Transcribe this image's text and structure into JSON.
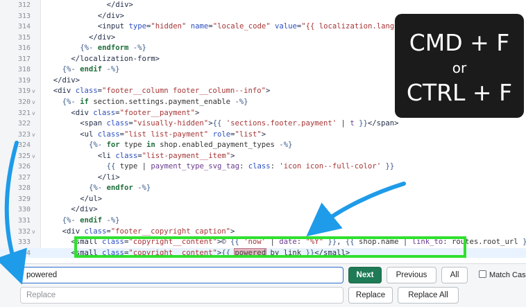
{
  "editor": {
    "lines": [
      {
        "num": "312",
        "fold": "",
        "indent": 14,
        "seg": [
          [
            "t-tag",
            "</div>"
          ]
        ]
      },
      {
        "num": "313",
        "fold": "",
        "indent": 12,
        "seg": [
          [
            "t-tag",
            "</div>"
          ]
        ]
      },
      {
        "num": "314",
        "fold": "",
        "indent": 12,
        "seg": [
          [
            "t-tag",
            "<input "
          ],
          [
            "t-attr",
            "type"
          ],
          [
            "t-tag",
            "="
          ],
          [
            "t-str",
            "\"hidden\""
          ],
          [
            "t-tag",
            " "
          ],
          [
            "t-attr",
            "name"
          ],
          [
            "t-tag",
            "="
          ],
          [
            "t-str",
            "\"locale_code\""
          ],
          [
            "t-tag",
            " "
          ],
          [
            "t-attr",
            "value"
          ],
          [
            "t-tag",
            "="
          ],
          [
            "t-str",
            "\"{{ localization.language.iso_code }}\">"
          ]
        ]
      },
      {
        "num": "315",
        "fold": "",
        "indent": 10,
        "seg": [
          [
            "t-tag",
            "</div>"
          ]
        ]
      },
      {
        "num": "316",
        "fold": "",
        "indent": 8,
        "seg": [
          [
            "t-liq",
            "{%- "
          ],
          [
            "t-kw",
            "endform"
          ],
          [
            "t-liq",
            " -%}"
          ]
        ]
      },
      {
        "num": "317",
        "fold": "",
        "indent": 6,
        "seg": [
          [
            "t-tag",
            "</localization-form>"
          ]
        ]
      },
      {
        "num": "318",
        "fold": "",
        "indent": 4,
        "seg": [
          [
            "t-liq",
            "{%- "
          ],
          [
            "t-kw",
            "endif"
          ],
          [
            "t-liq",
            " -%}"
          ]
        ]
      },
      {
        "num": "319",
        "fold": "",
        "indent": 2,
        "seg": [
          [
            "t-tag",
            "</div>"
          ]
        ]
      },
      {
        "num": "319",
        "fold": "v",
        "indent": 2,
        "seg": [
          [
            "t-tag",
            "<div "
          ],
          [
            "t-attr",
            "class"
          ],
          [
            "t-tag",
            "="
          ],
          [
            "t-str",
            "\"footer__column footer__column--info\""
          ],
          [
            "t-tag",
            ">"
          ]
        ]
      },
      {
        "num": "320",
        "fold": "v",
        "indent": 4,
        "seg": [
          [
            "t-liq",
            "{%- "
          ],
          [
            "t-kw",
            "if"
          ],
          [
            "t-var",
            " section.settings.payment_enable "
          ],
          [
            "t-liq",
            "-%}"
          ]
        ]
      },
      {
        "num": "321",
        "fold": "v",
        "indent": 6,
        "seg": [
          [
            "t-tag",
            "<div "
          ],
          [
            "t-attr",
            "class"
          ],
          [
            "t-tag",
            "="
          ],
          [
            "t-str",
            "\"footer__payment\""
          ],
          [
            "t-tag",
            ">"
          ]
        ]
      },
      {
        "num": "322",
        "fold": "",
        "indent": 8,
        "seg": [
          [
            "t-tag",
            "<span "
          ],
          [
            "t-attr",
            "class"
          ],
          [
            "t-tag",
            "="
          ],
          [
            "t-str",
            "\"visually-hidden\""
          ],
          [
            "t-tag",
            ">"
          ],
          [
            "t-liq",
            "{{ "
          ],
          [
            "t-str",
            "'sections.footer.payment'"
          ],
          [
            "t-var",
            " | "
          ],
          [
            "t-fn",
            "t"
          ],
          [
            "t-liq",
            " }}"
          ],
          [
            "t-tag",
            "</span>"
          ]
        ]
      },
      {
        "num": "323",
        "fold": "v",
        "indent": 8,
        "seg": [
          [
            "t-tag",
            "<ul "
          ],
          [
            "t-attr",
            "class"
          ],
          [
            "t-tag",
            "="
          ],
          [
            "t-str",
            "\"list list-payment\""
          ],
          [
            "t-tag",
            " "
          ],
          [
            "t-attr",
            "role"
          ],
          [
            "t-tag",
            "="
          ],
          [
            "t-str",
            "\"list\""
          ],
          [
            "t-tag",
            ">"
          ]
        ]
      },
      {
        "num": "324",
        "fold": "",
        "indent": 10,
        "seg": [
          [
            "t-liq",
            "{%- "
          ],
          [
            "t-kw",
            "for"
          ],
          [
            "t-var",
            " type "
          ],
          [
            "t-kw",
            "in"
          ],
          [
            "t-var",
            " shop.enabled_payment_types "
          ],
          [
            "t-liq",
            "-%}"
          ]
        ]
      },
      {
        "num": "325",
        "fold": "v",
        "indent": 12,
        "seg": [
          [
            "t-tag",
            "<li "
          ],
          [
            "t-attr",
            "class"
          ],
          [
            "t-tag",
            "="
          ],
          [
            "t-str",
            "\"list-payment__item\""
          ],
          [
            "t-tag",
            ">"
          ]
        ]
      },
      {
        "num": "326",
        "fold": "",
        "indent": 14,
        "seg": [
          [
            "t-liq",
            "{{ "
          ],
          [
            "t-var",
            "type | "
          ],
          [
            "t-fn",
            "payment_type_svg_tag"
          ],
          [
            "t-var",
            ": "
          ],
          [
            "t-attr",
            "class"
          ],
          [
            "t-var",
            ": "
          ],
          [
            "t-str",
            "'icon icon--full-color'"
          ],
          [
            "t-liq",
            " }}"
          ]
        ]
      },
      {
        "num": "327",
        "fold": "",
        "indent": 12,
        "seg": [
          [
            "t-tag",
            "</li>"
          ]
        ]
      },
      {
        "num": "328",
        "fold": "",
        "indent": 10,
        "seg": [
          [
            "t-liq",
            "{%- "
          ],
          [
            "t-kw",
            "endfor"
          ],
          [
            "t-liq",
            " -%}"
          ]
        ]
      },
      {
        "num": "329",
        "fold": "",
        "indent": 8,
        "seg": [
          [
            "t-tag",
            "</ul>"
          ]
        ]
      },
      {
        "num": "330",
        "fold": "",
        "indent": 6,
        "seg": [
          [
            "t-tag",
            "</div>"
          ]
        ]
      },
      {
        "num": "331",
        "fold": "",
        "indent": 4,
        "seg": [
          [
            "t-liq",
            "{%- "
          ],
          [
            "t-kw",
            "endif"
          ],
          [
            "t-liq",
            " -%}"
          ]
        ]
      },
      {
        "num": "332",
        "fold": "v",
        "indent": 4,
        "seg": [
          [
            "t-tag",
            "<div "
          ],
          [
            "t-attr",
            "class"
          ],
          [
            "t-tag",
            "="
          ],
          [
            "t-str",
            "\"footer__copyright caption\""
          ],
          [
            "t-tag",
            ">"
          ]
        ]
      },
      {
        "num": "333",
        "fold": "",
        "indent": 6,
        "seg": [
          [
            "t-tag",
            "<small "
          ],
          [
            "t-attr",
            "class"
          ],
          [
            "t-tag",
            "="
          ],
          [
            "t-str",
            "\"copyright__content\""
          ],
          [
            "t-tag",
            ">&copy; "
          ],
          [
            "t-liq",
            "{{ "
          ],
          [
            "t-str",
            "'now'"
          ],
          [
            "t-var",
            " | "
          ],
          [
            "t-fn",
            "date"
          ],
          [
            "t-var",
            ": "
          ],
          [
            "t-str",
            "\"%Y\""
          ],
          [
            "t-liq",
            " }}"
          ],
          [
            "t-tag",
            ", "
          ],
          [
            "t-liq",
            "{{ "
          ],
          [
            "t-var",
            "shop.name | "
          ],
          [
            "t-fn",
            "link_to"
          ],
          [
            "t-var",
            ": routes.root_url "
          ],
          [
            "t-liq",
            "}}"
          ],
          [
            "t-tag",
            "</small>"
          ]
        ]
      },
      {
        "num": "334",
        "fold": "",
        "indent": 6,
        "active": true,
        "seg": [
          [
            "t-tag",
            "<small "
          ],
          [
            "t-attr",
            "class"
          ],
          [
            "t-tag",
            "="
          ],
          [
            "t-str",
            "\"copyright__content\""
          ],
          [
            "t-tag",
            ">"
          ],
          [
            "t-liq",
            "{{ "
          ],
          [
            "hl-match",
            "powered"
          ],
          [
            "t-var",
            "_by_link "
          ],
          [
            "t-liq",
            "}}"
          ],
          [
            "t-tag",
            "</small>"
          ]
        ]
      }
    ]
  },
  "hint": {
    "line1": "CMD + F",
    "line2": "or",
    "line3": "CTRL + F"
  },
  "icons": {
    "arrow_left": "curved-arrow-icon",
    "arrow_right": "diagonal-arrow-icon"
  },
  "colors": {
    "arrow": "#1e9be9",
    "highlight_box": "#2fe02f",
    "next_button": "#1f7a56",
    "hint_card": "#1b1b1c"
  },
  "findbar": {
    "find_value": "powered",
    "replace_placeholder": "Replace",
    "next_label": "Next",
    "previous_label": "Previous",
    "all_label": "All",
    "match_case_label": "Match Case",
    "replace_label": "Replace",
    "replace_all_label": "Replace All"
  }
}
